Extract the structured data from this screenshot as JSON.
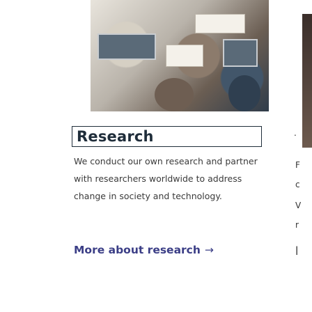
{
  "card": {
    "heading": "Research",
    "body": "We conduct our own research and partner with researchers worldwide to address change in society and technology.",
    "link": "More about research",
    "link_arrow": "→"
  },
  "next_card_fragments": [
    "F",
    "c",
    "V",
    "r",
    "|"
  ],
  "prev_card_fragments": [
    "."
  ]
}
